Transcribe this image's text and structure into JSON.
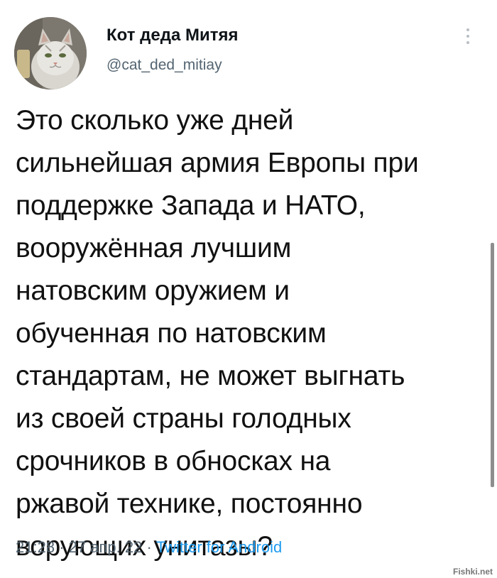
{
  "tweet": {
    "author": {
      "display_name": "Кот деда Митяя",
      "handle": "@cat_ded_mitiay",
      "avatar_icon": "cat-avatar-icon"
    },
    "text": "Это сколько уже дней\nсильнейшая армия Европы при\nподдержке Запада и НАТО,\nвооружённая лучшим\nнатовским оружием и\nобученная по натовским\nстандартам, не может выгнать\nиз своей страны голодных\nсрочников в обносках на\nржавой технике, постоянно\nворующих унитазы?",
    "time": "21:28",
    "date": "27 апр. 22",
    "separator": "·",
    "source": "Twitter for Android",
    "source_color": "#1d9bf0",
    "more_icon": "more-vertical-icon"
  },
  "watermark": "Fishki.net"
}
